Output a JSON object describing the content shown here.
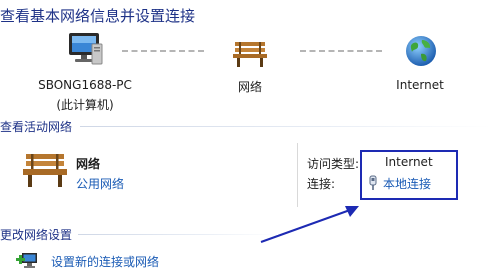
{
  "header": {
    "title": "查看基本网络信息并设置连接"
  },
  "network_map": {
    "nodes": [
      {
        "name": "SBONG1688-PC",
        "sub": "(此计算机)",
        "icon": "computer-icon"
      },
      {
        "name": "网络",
        "icon": "bench-icon"
      },
      {
        "name": "Internet",
        "icon": "globe-icon"
      }
    ]
  },
  "active_networks": {
    "header": "查看活动网络",
    "network_name": "网络",
    "network_type": "公用网络",
    "access_type_label": "访问类型:",
    "access_type_value": "Internet",
    "connections_label": "连接:",
    "connection_value": "本地连接"
  },
  "change_settings": {
    "header": "更改网络设置",
    "setup_link": "设置新的连接或网络"
  },
  "colors": {
    "title": "#1e3287",
    "link": "#1a5bb5",
    "annotation": "#1d2ab3"
  }
}
